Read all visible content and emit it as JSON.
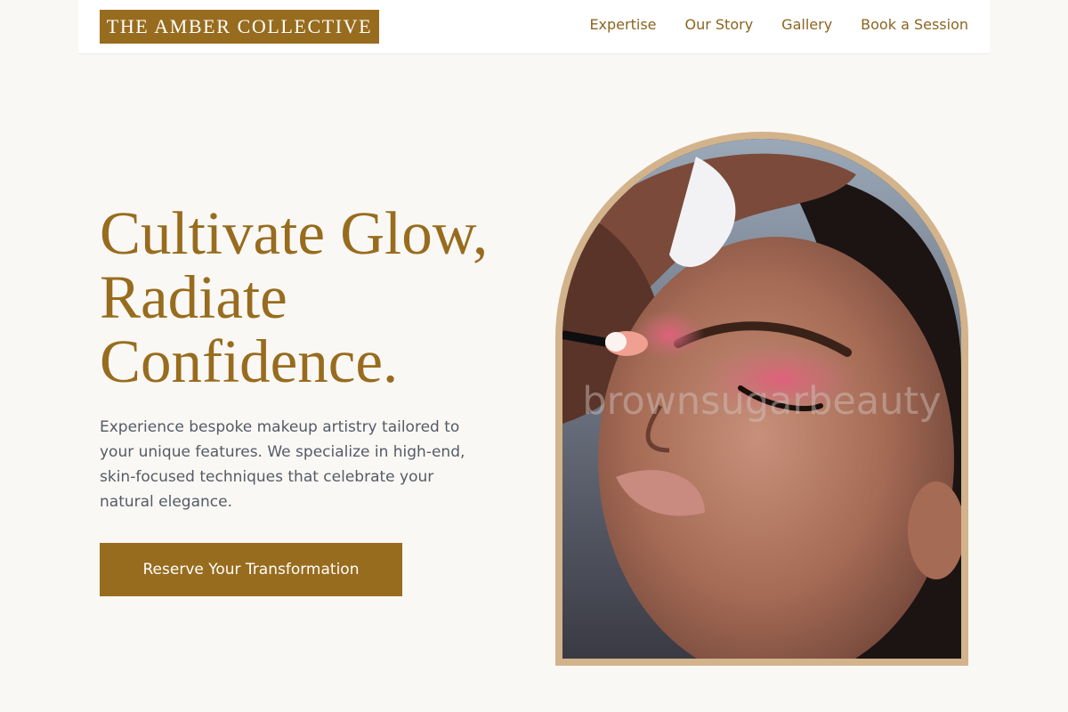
{
  "header": {
    "logo": "THE AMBER COLLECTIVE",
    "nav": [
      "Expertise",
      "Our Story",
      "Gallery",
      "Book a Session"
    ]
  },
  "hero": {
    "title_lines": [
      "Cultivate Glow,",
      "Radiate",
      "Confidence."
    ],
    "description_lines": [
      "Experience bespoke makeup artistry tailored to",
      "your unique features. We specialize in high-end,",
      "skin-focused techniques that celebrate your",
      "natural elegance."
    ],
    "cta_label": "Reserve Your Transformation"
  },
  "image": {
    "watermark": "brownsugarbeauty",
    "subject": "makeup application close-up photo"
  },
  "colors": {
    "brand": "#986c1e",
    "background": "#faf8f5",
    "frame": "#d2b38b",
    "body_text": "#545b66"
  }
}
